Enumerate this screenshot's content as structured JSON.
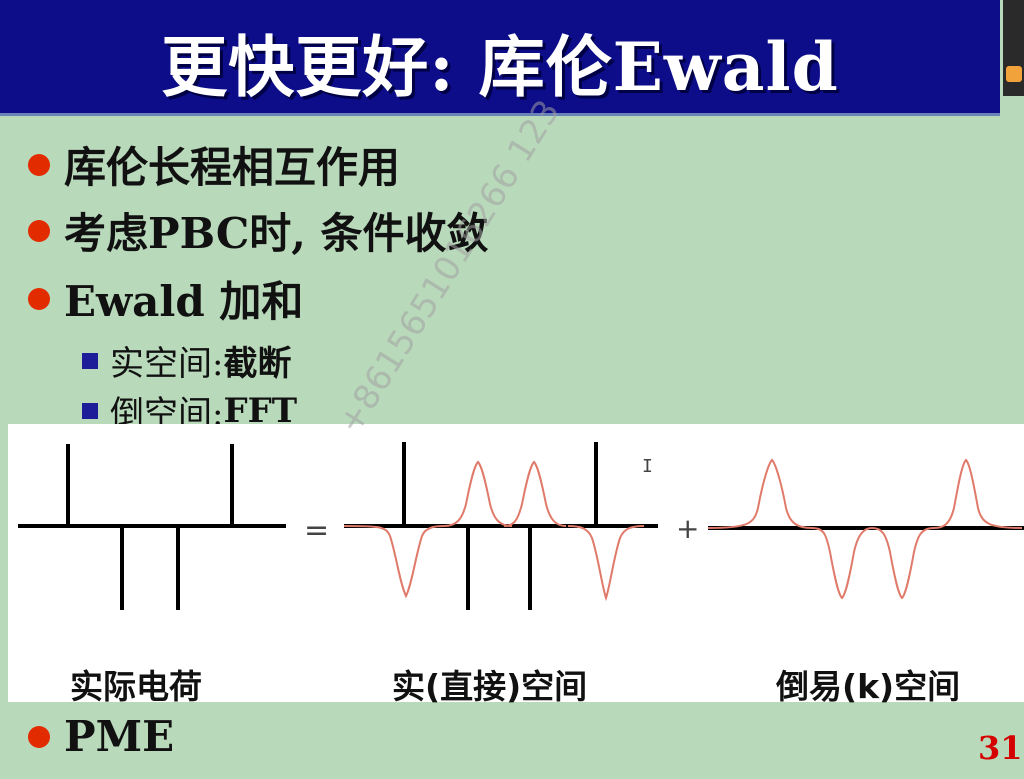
{
  "slide": {
    "title": "更快更好: 库伦Ewald",
    "bullets": [
      {
        "text": "库伦长程相互作用"
      },
      {
        "text": "考虑PBC时, 条件收敛"
      },
      {
        "text": "Ewald 加和"
      }
    ],
    "sub_bullets": [
      {
        "label": "实空间: ",
        "value": "截断"
      },
      {
        "label": "倒空间: ",
        "value": "FFT"
      }
    ],
    "bottom_bullet": "PME",
    "page_number": "31"
  },
  "diagram": {
    "operators": {
      "equals": "=",
      "plus": "+"
    },
    "captions": [
      "实际电荷",
      "实(直接)空间",
      "倒易(k)空间"
    ]
  },
  "watermark": "+8615651016266 123",
  "colors": {
    "title_bg": "#0d0d8a",
    "slide_bg": "#b9d9bb",
    "bullet_dot": "#e32b00",
    "sub_bullet_square": "#1d1d9a",
    "gaussian_curve": "#e07a6a",
    "page_number": "#d40000"
  },
  "icons": [
    "text-cursor-icon",
    "user-icon"
  ]
}
